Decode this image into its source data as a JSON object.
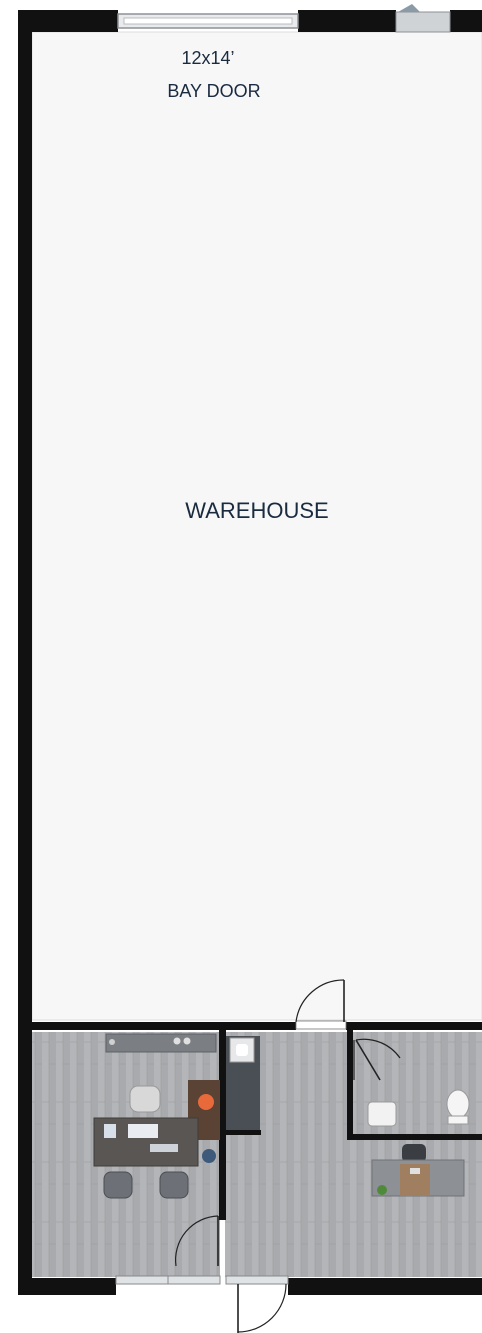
{
  "labels": {
    "bay_door_size": "12x14’",
    "bay_door_name": "BAY DOOR",
    "warehouse": "WAREHOUSE"
  },
  "colors": {
    "wall": "#111111",
    "warehouse_floor": "#f7f7f7",
    "wood_floor": "#a9abae",
    "desk": "#5a5654",
    "text": "#1a2b40"
  },
  "icons": [
    "bay-door",
    "door-swing",
    "desk",
    "chair",
    "toilet",
    "sink",
    "plant",
    "window"
  ]
}
